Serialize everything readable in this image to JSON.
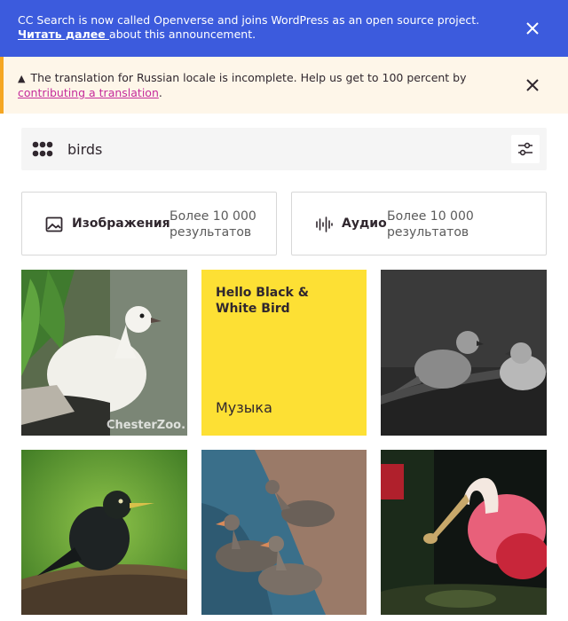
{
  "announcement": {
    "text": "CC Search is now called Openverse and joins WordPress as an open source project.",
    "link": "Читать далее ",
    "suffix": "about this announcement.",
    "background": "#3c5bdd"
  },
  "translation_notice": {
    "icon": "warning-icon",
    "text": "The translation for Russian locale is incomplete. Help us get to 100 percent by",
    "link": "contributing a translation",
    "suffix": ".",
    "background": "#fef6e9"
  },
  "search": {
    "value": "birds",
    "logo_icon": "openverse-logo-icon",
    "filter_icon": "filter-sliders-icon"
  },
  "content_types": [
    {
      "label": "Изображения",
      "count": "Более 10 000 результатов",
      "icon": "image-icon"
    },
    {
      "label": "Аудио",
      "count": "Более 10 000 результатов",
      "icon": "audio-waveform-icon"
    }
  ],
  "results": {
    "audio_card": {
      "title": "Hello Black & White Bird",
      "genre": "Музыка",
      "background": "#fde034"
    },
    "dove_watermark": "ChesterZoo."
  }
}
